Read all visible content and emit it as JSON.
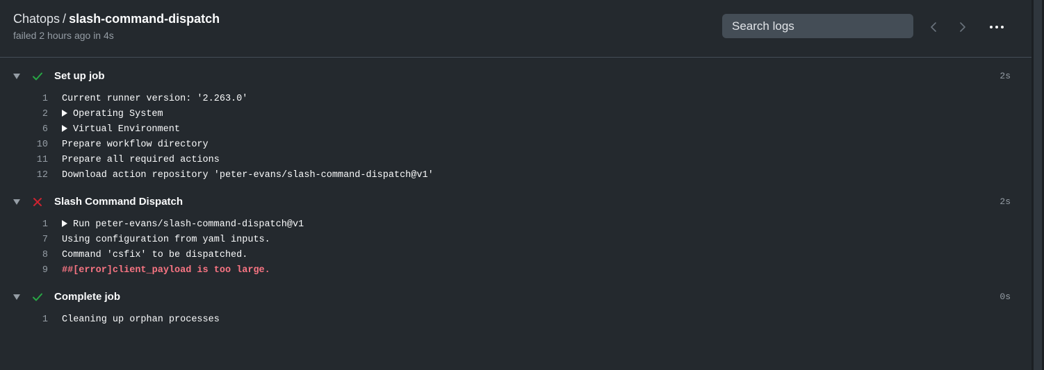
{
  "header": {
    "workflow": "Chatops",
    "separator": "/",
    "job": "slash-command-dispatch",
    "status_line": "failed 2 hours ago in 4s",
    "search_placeholder": "Search logs",
    "icons": {
      "prev": "chevron-left-icon",
      "next": "chevron-right-icon",
      "more": "kebab-horizontal-icon"
    }
  },
  "colors": {
    "success": "#28a745",
    "failure": "#cb2431",
    "error_text": "#f97583"
  },
  "steps": [
    {
      "name": "Set up job",
      "status": "success",
      "duration": "2s",
      "lines": [
        {
          "n": "1",
          "text": "Current runner version: '2.263.0'",
          "group": false,
          "error": false
        },
        {
          "n": "2",
          "text": "Operating System",
          "group": true,
          "error": false
        },
        {
          "n": "6",
          "text": "Virtual Environment",
          "group": true,
          "error": false
        },
        {
          "n": "10",
          "text": "Prepare workflow directory",
          "group": false,
          "error": false
        },
        {
          "n": "11",
          "text": "Prepare all required actions",
          "group": false,
          "error": false
        },
        {
          "n": "12",
          "text": "Download action repository 'peter-evans/slash-command-dispatch@v1'",
          "group": false,
          "error": false
        }
      ]
    },
    {
      "name": "Slash Command Dispatch",
      "status": "failure",
      "duration": "2s",
      "lines": [
        {
          "n": "1",
          "text": "Run peter-evans/slash-command-dispatch@v1",
          "group": true,
          "error": false
        },
        {
          "n": "7",
          "text": "Using configuration from yaml inputs.",
          "group": false,
          "error": false
        },
        {
          "n": "8",
          "text": "Command 'csfix' to be dispatched.",
          "group": false,
          "error": false
        },
        {
          "n": "9",
          "text": "##[error]client_payload is too large.",
          "group": false,
          "error": true
        }
      ]
    },
    {
      "name": "Complete job",
      "status": "success",
      "duration": "0s",
      "lines": [
        {
          "n": "1",
          "text": "Cleaning up orphan processes",
          "group": false,
          "error": false
        }
      ]
    }
  ]
}
